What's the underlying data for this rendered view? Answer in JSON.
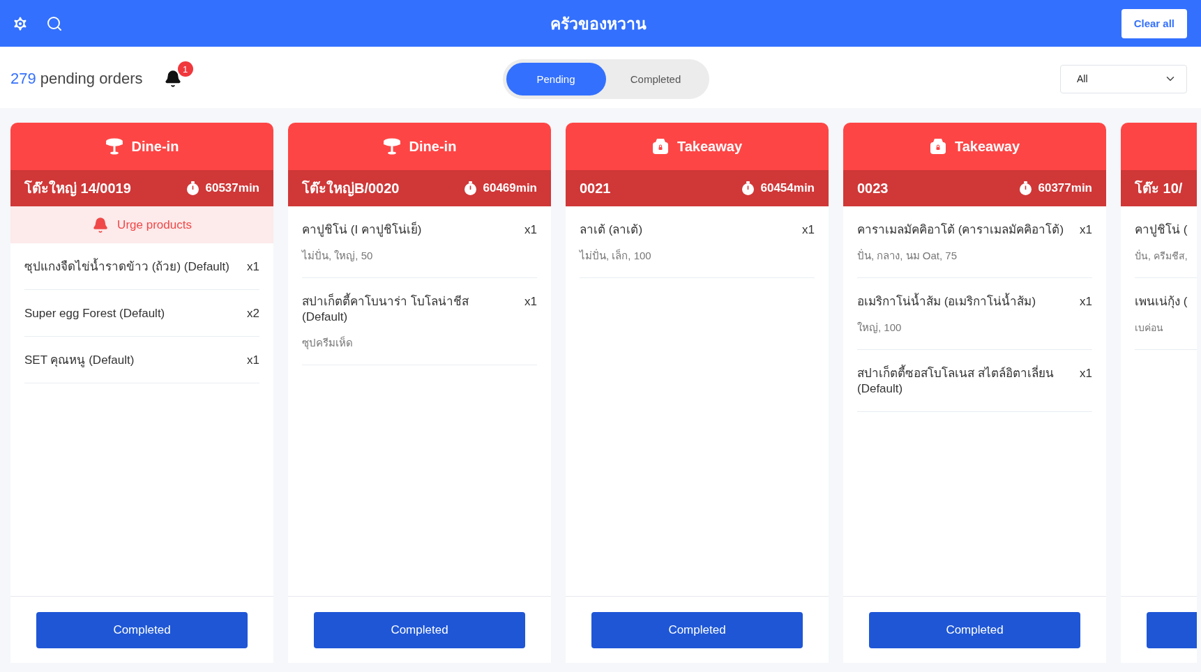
{
  "header": {
    "title": "ครัวของหวาน",
    "clear_button": "Clear all"
  },
  "summary": {
    "count": "279",
    "label": "pending orders",
    "notifications": "1"
  },
  "tabs": [
    {
      "label": "Pending",
      "selected": true
    },
    {
      "label": "Completed",
      "selected": false
    }
  ],
  "filter": {
    "value": "All"
  },
  "orders": [
    {
      "kind": "dine-in",
      "type_label": "Dine-in",
      "table": "โต๊ะใหญ่ 14/0019",
      "elapsed": "60537min",
      "urge": "Urge products",
      "items": [
        {
          "name": "ซุปแกงจืดไข่น้ำราดข้าว (ถ้วย) (Default)",
          "qty": "x1"
        },
        {
          "name": "Super egg Forest (Default)",
          "qty": "x2"
        },
        {
          "name": "SET คุณหนู (Default)",
          "qty": "x1"
        }
      ],
      "button": "Completed"
    },
    {
      "kind": "dine-in",
      "type_label": "Dine-in",
      "table": "โต๊ะใหญ่B/0020",
      "elapsed": "60469min",
      "items": [
        {
          "name": "คาปูชิโน่ (I คาปูชิโน่เย็)",
          "qty": "x1",
          "options": "ไม่ปั่น, ใหญ่, 50"
        },
        {
          "name": "สปาเก็ตตี้คาโบนาร่า โบโลน่าชีส (Default)",
          "qty": "x1",
          "options": "ซุปครีมเห็ด"
        }
      ],
      "button": "Completed"
    },
    {
      "kind": "takeaway",
      "type_label": "Takeaway",
      "table": "0021",
      "elapsed": "60454min",
      "items": [
        {
          "name": "ลาเต้ (ลาเต้)",
          "qty": "x1",
          "options": "ไม่ปั่น, เล็ก, 100"
        }
      ],
      "button": "Completed"
    },
    {
      "kind": "takeaway",
      "type_label": "Takeaway",
      "table": "0023",
      "elapsed": "60377min",
      "items": [
        {
          "name": "คาราเมลมัคคิอาโต้ (คาราเมลมัคคิอาโต้)",
          "qty": "x1",
          "options": "ปั่น, กลาง, นม Oat, 75"
        },
        {
          "name": "อเมริกาโน่น้ำส้ม (อเมริกาโน่น้ำส้ม)",
          "qty": "x1",
          "options": "ใหญ่, 100"
        },
        {
          "name": "สปาเก็ตตี้ซอสโบโลเนส สไตล์อิตาเลี่ยน (Default)",
          "qty": "x1"
        }
      ],
      "button": "Completed"
    },
    {
      "table": "โต๊ะ 10/",
      "items": [
        {
          "name": "คาปูชิโน่ (",
          "options": "ปั่น, ครีมชีส,"
        },
        {
          "name": "เพนเน่กุ้ง (",
          "options": "เบค่อน"
        }
      ]
    }
  ]
}
